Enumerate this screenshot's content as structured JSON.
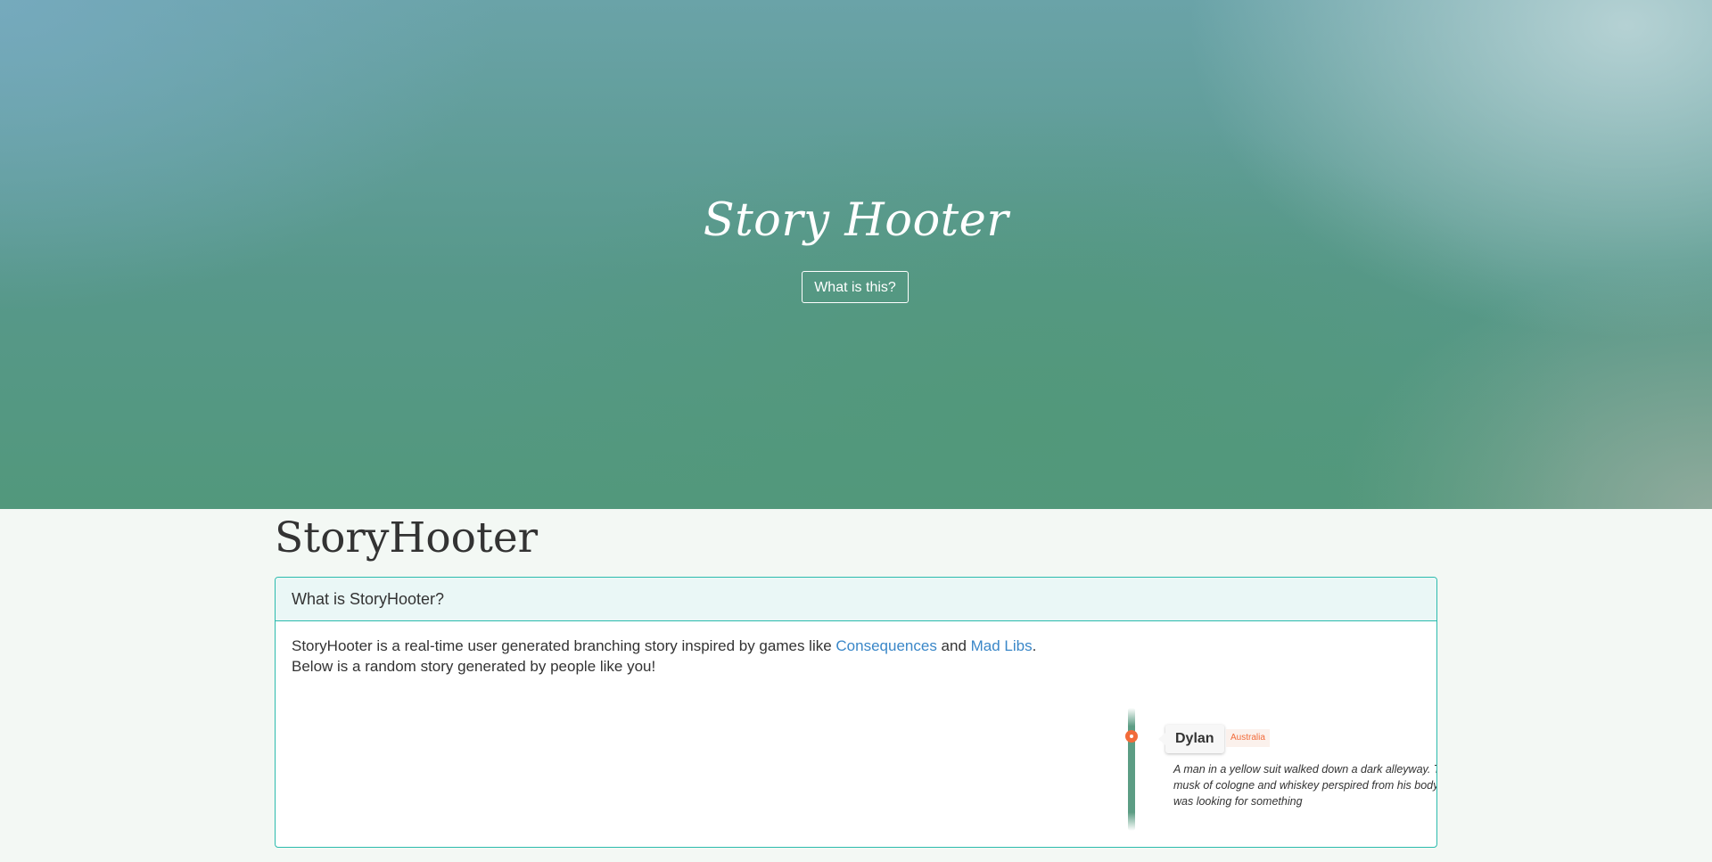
{
  "hero": {
    "title": "Story Hooter",
    "button_label": "What is this?"
  },
  "main": {
    "page_title": "StoryHooter",
    "panel": {
      "heading": "What is StoryHooter?",
      "intro_before": "StoryHooter is a real-time user generated branching story inspired by games like ",
      "link_consequences": "Consequences",
      "intro_and": " and ",
      "link_madlibs": "Mad Libs",
      "intro_end": ".",
      "line2": "Below is a random story generated by people like you!"
    },
    "story": {
      "author": "Dylan",
      "country": "Australia",
      "text": "A man in a yellow suit walked down a dark alleyway. The musk of cologne and whiskey perspired from his body. He was looking for something"
    }
  },
  "colors": {
    "accent": "#2bbbad",
    "link": "#3a87c8",
    "marker": "#f26b3a",
    "hero_green": "#52987c"
  },
  "icons": {
    "timeline_marker": "circle-dot-icon"
  }
}
